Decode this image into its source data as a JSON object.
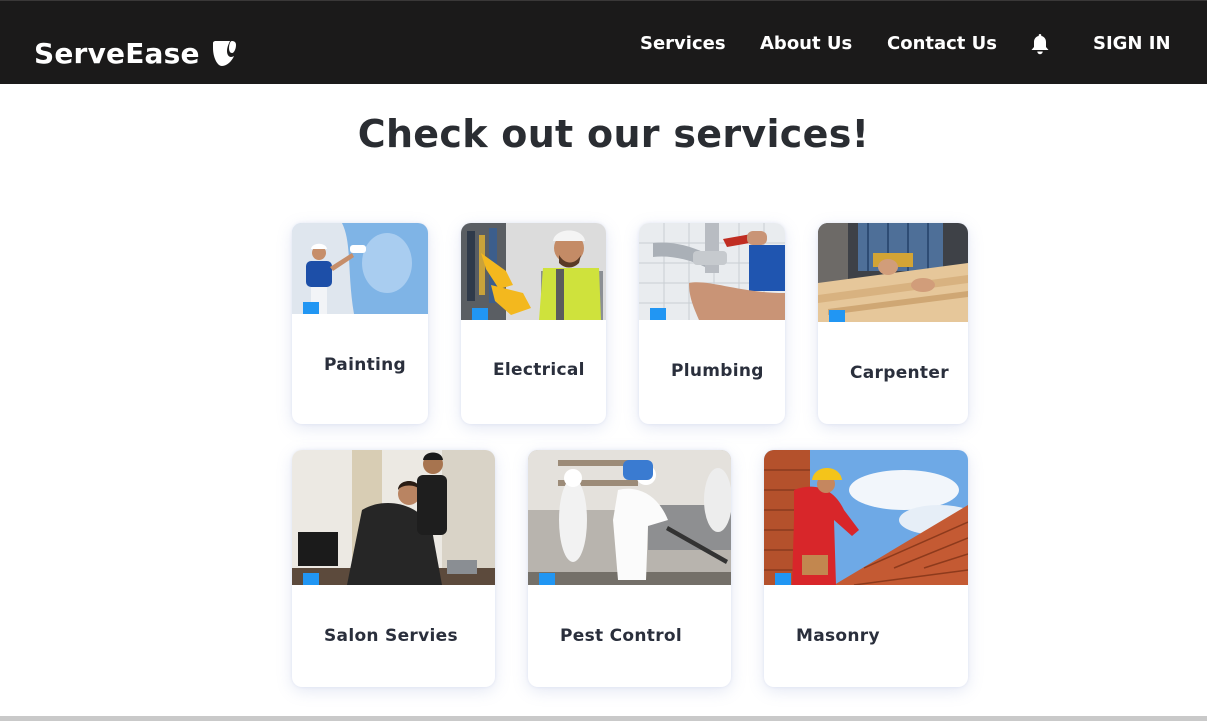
{
  "brand": {
    "name": "ServeEase",
    "logo_icon": "typo3-logo-icon"
  },
  "nav": {
    "services": "Services",
    "about": "About Us",
    "contact": "Contact Us",
    "bell_icon": "bell-icon",
    "signin": "SIGN IN"
  },
  "page": {
    "title": "Check out our services!"
  },
  "services": [
    {
      "label": "Painting"
    },
    {
      "label": "Electrical"
    },
    {
      "label": "Plumbing"
    },
    {
      "label": "Carpenter"
    },
    {
      "label": "Salon Servies"
    },
    {
      "label": "Pest Control"
    },
    {
      "label": "Masonry"
    }
  ],
  "colors": {
    "navbar": "#1b1a1a",
    "accent": "#2196f3",
    "text_dark": "#2a2f3c"
  }
}
